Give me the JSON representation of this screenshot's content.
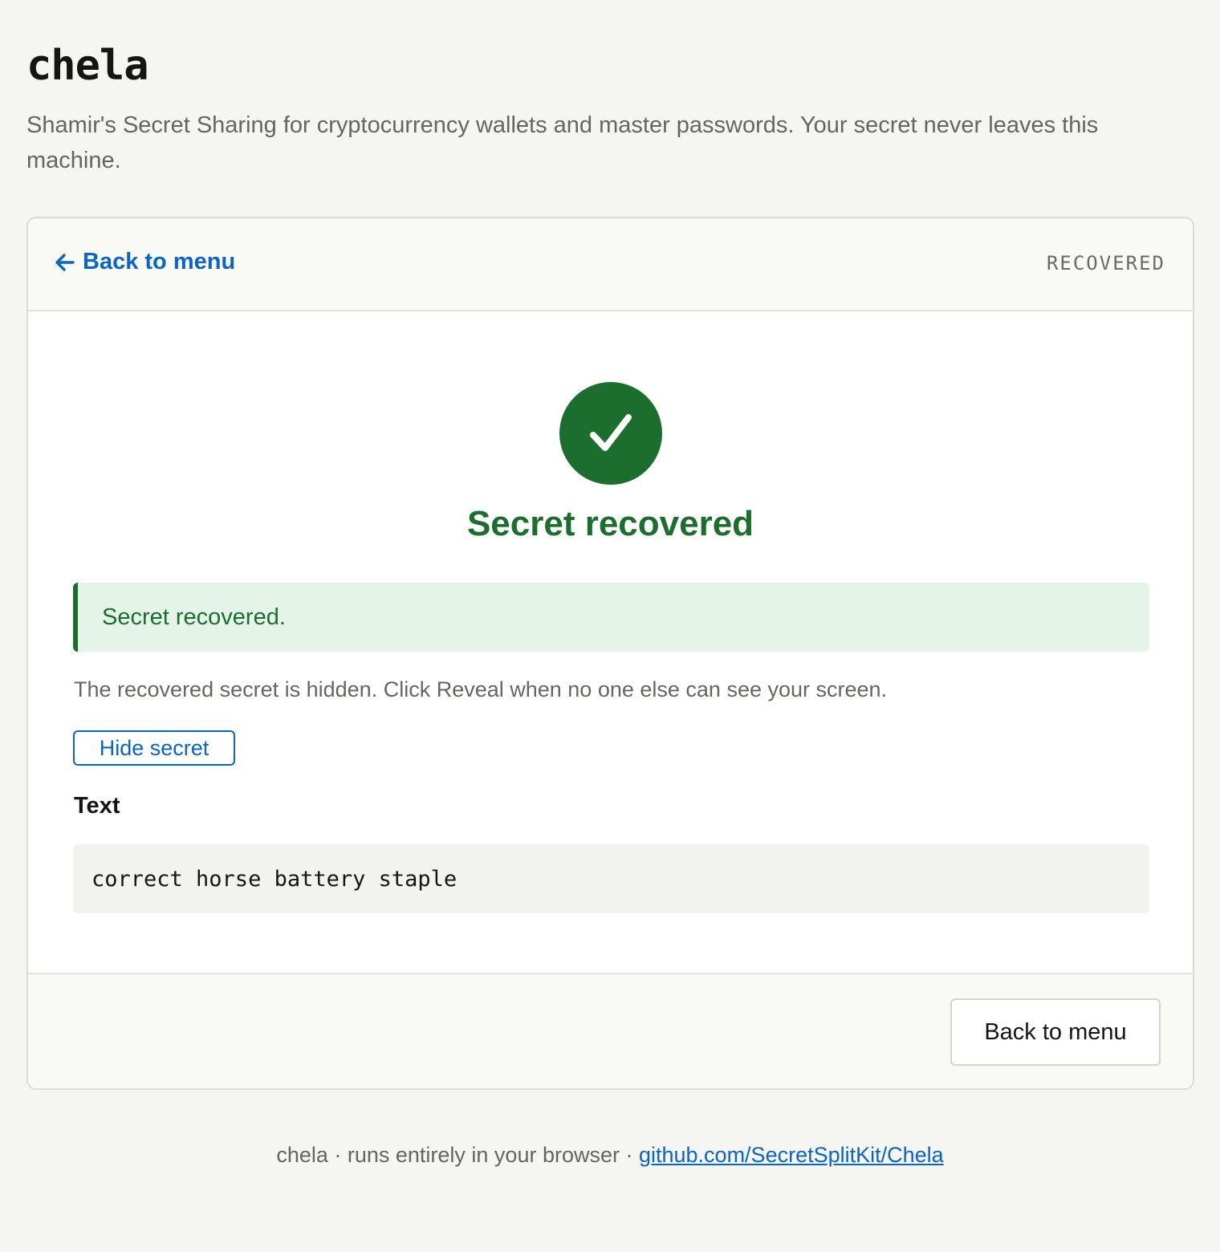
{
  "header": {
    "title": "chela",
    "subtitle": "Shamir's Secret Sharing for cryptocurrency wallets and master passwords. Your secret never leaves this machine."
  },
  "card": {
    "back_link": {
      "label": "Back to menu",
      "icon": "arrow-left-icon"
    },
    "status": "RECOVERED",
    "success_icon": "checkmark-icon",
    "success_title": "Secret recovered",
    "alert": "Secret recovered.",
    "hint": "The recovered secret is hidden. Click Reveal when no one else can see your screen.",
    "toggle_button": "Hide secret",
    "field_label": "Text",
    "secret_value": "correct horse battery staple",
    "footer_button": "Back to menu"
  },
  "footer": {
    "text": "chela · runs entirely in your browser · ",
    "link": "github.com/SecretSplitKit/Chela"
  },
  "colors": {
    "accent": "#0b66c3",
    "success": "#1c6e2e",
    "success_bg": "#e4f4e8",
    "page_bg": "#f5f5f1"
  }
}
